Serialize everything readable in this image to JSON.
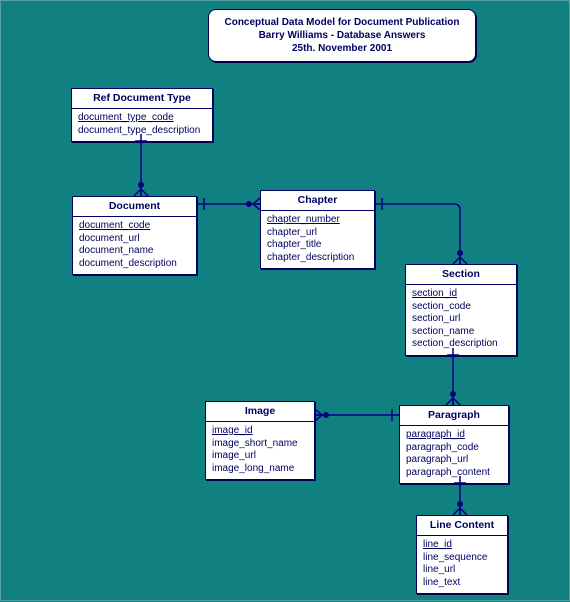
{
  "title": {
    "line1": "Conceptual Data Model for Document Publication",
    "line2": "Barry Williams - Database Answers",
    "line3": "25th. November 2001"
  },
  "entities": {
    "refDocType": {
      "name": "Ref Document Type",
      "attrs": [
        "document_type_code",
        "document_type_description"
      ],
      "pk": [
        0
      ]
    },
    "document": {
      "name": "Document",
      "attrs": [
        "document_code",
        "document_url",
        "document_name",
        "document_description"
      ],
      "pk": [
        0
      ]
    },
    "chapter": {
      "name": "Chapter",
      "attrs": [
        "chapter_number",
        "chapter_url",
        "chapter_title",
        "chapter_description"
      ],
      "pk": [
        0
      ]
    },
    "section": {
      "name": "Section",
      "attrs": [
        "section_id",
        "section_code",
        "section_url",
        "section_name",
        "section_description"
      ],
      "pk": [
        0
      ]
    },
    "paragraph": {
      "name": "Paragraph",
      "attrs": [
        "paragraph_id",
        "paragraph_code",
        "paragraph_url",
        "paragraph_content"
      ],
      "pk": [
        0
      ]
    },
    "image": {
      "name": "Image",
      "attrs": [
        "image_id",
        "image_short_name",
        "image_url",
        "image_long_name"
      ],
      "pk": [
        0
      ]
    },
    "lineContent": {
      "name": "Line Content",
      "attrs": [
        "line_id",
        "line_sequence",
        "line_url",
        "line_text"
      ],
      "pk": [
        0
      ]
    }
  },
  "chart_data": {
    "type": "er-diagram",
    "title": "Conceptual Data Model for Document Publication",
    "entities": [
      {
        "name": "Ref Document Type",
        "pk": [
          "document_type_code"
        ],
        "attrs": [
          "document_type_description"
        ]
      },
      {
        "name": "Document",
        "pk": [
          "document_code"
        ],
        "attrs": [
          "document_url",
          "document_name",
          "document_description"
        ]
      },
      {
        "name": "Chapter",
        "pk": [
          "chapter_number"
        ],
        "attrs": [
          "chapter_url",
          "chapter_title",
          "chapter_description"
        ]
      },
      {
        "name": "Section",
        "pk": [
          "section_id"
        ],
        "attrs": [
          "section_code",
          "section_url",
          "section_name",
          "section_description"
        ]
      },
      {
        "name": "Paragraph",
        "pk": [
          "paragraph_id"
        ],
        "attrs": [
          "paragraph_code",
          "paragraph_url",
          "paragraph_content"
        ]
      },
      {
        "name": "Image",
        "pk": [
          "image_id"
        ],
        "attrs": [
          "image_short_name",
          "image_url",
          "image_long_name"
        ]
      },
      {
        "name": "Line Content",
        "pk": [
          "line_id"
        ],
        "attrs": [
          "line_sequence",
          "line_url",
          "line_text"
        ]
      }
    ],
    "relationships": [
      {
        "from": "Ref Document Type",
        "to": "Document",
        "cardinality": "1..*"
      },
      {
        "from": "Document",
        "to": "Chapter",
        "cardinality": "1..*"
      },
      {
        "from": "Chapter",
        "to": "Section",
        "cardinality": "1..*"
      },
      {
        "from": "Section",
        "to": "Paragraph",
        "cardinality": "1..*"
      },
      {
        "from": "Paragraph",
        "to": "Image",
        "cardinality": "1..*"
      },
      {
        "from": "Paragraph",
        "to": "Line Content",
        "cardinality": "1..*"
      }
    ]
  }
}
